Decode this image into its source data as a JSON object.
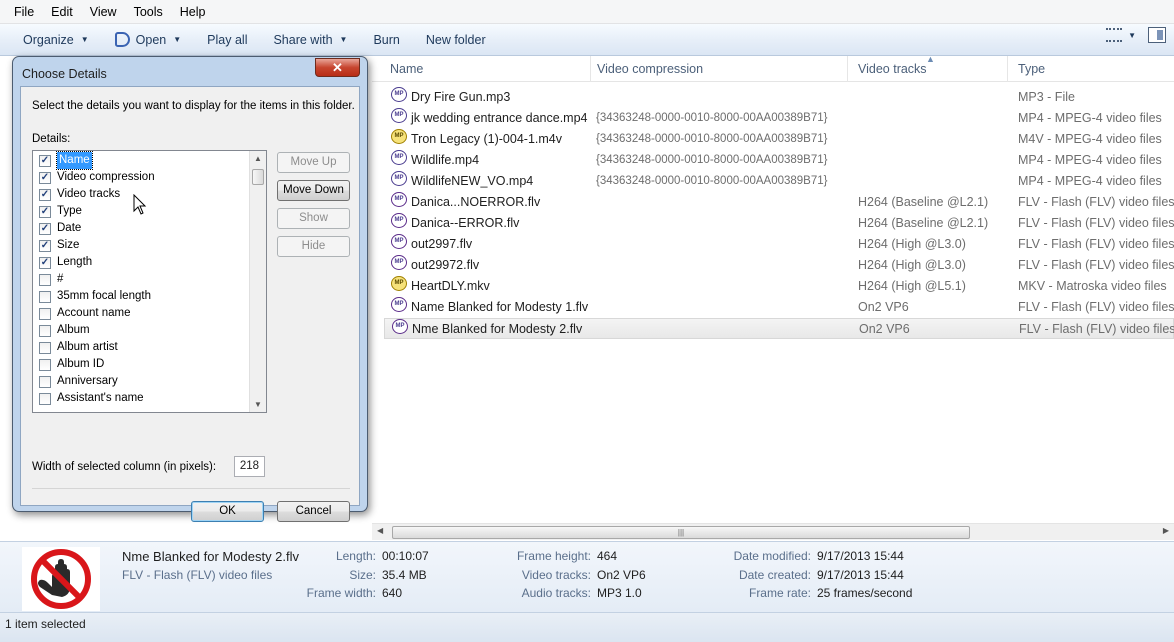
{
  "menu": [
    "File",
    "Edit",
    "View",
    "Tools",
    "Help"
  ],
  "toolbar": {
    "organize": "Organize",
    "open": "Open",
    "play_all": "Play all",
    "share_with": "Share with",
    "burn": "Burn",
    "new_folder": "New folder"
  },
  "columns": {
    "name": "Name",
    "video_compression": "Video compression",
    "video_tracks": "Video tracks",
    "type": "Type"
  },
  "files": [
    {
      "name": "Dry Fire Gun.mp3",
      "compression": "",
      "tracks": "",
      "type": "MP3 - File",
      "icon": "media-file-icon"
    },
    {
      "name": "jk wedding entrance dance.mp4",
      "compression": "{34363248-0000-0010-8000-00AA00389B71}",
      "tracks": "",
      "type": "MP4 - MPEG-4 video files",
      "icon": "media-file-icon"
    },
    {
      "name": "Tron Legacy (1)-004-1.m4v",
      "compression": "{34363248-0000-0010-8000-00AA00389B71}",
      "tracks": "",
      "type": "M4V - MPEG-4 video files",
      "icon": "media-file-icon"
    },
    {
      "name": "Wildlife.mp4",
      "compression": "{34363248-0000-0010-8000-00AA00389B71}",
      "tracks": "",
      "type": "MP4 - MPEG-4 video files",
      "icon": "media-file-icon"
    },
    {
      "name": "WildlifeNEW_VO.mp4",
      "compression": "{34363248-0000-0010-8000-00AA00389B71}",
      "tracks": "",
      "type": "MP4 - MPEG-4 video files",
      "icon": "media-file-icon"
    },
    {
      "name": "Danica...NOERROR.flv",
      "compression": "",
      "tracks": "H264 (Baseline @L2.1)",
      "type": "FLV - Flash (FLV) video files",
      "icon": "flv-file-icon"
    },
    {
      "name": "Danica--ERROR.flv",
      "compression": "",
      "tracks": "H264 (Baseline @L2.1)",
      "type": "FLV - Flash (FLV) video files",
      "icon": "flv-file-icon"
    },
    {
      "name": "out2997.flv",
      "compression": "",
      "tracks": "H264 (High @L3.0)",
      "type": "FLV - Flash (FLV) video files",
      "icon": "flv-file-icon"
    },
    {
      "name": "out29972.flv",
      "compression": "",
      "tracks": "H264 (High @L3.0)",
      "type": "FLV - Flash (FLV) video files",
      "icon": "flv-file-icon"
    },
    {
      "name": "HeartDLY.mkv",
      "compression": "",
      "tracks": "H264 (High @L5.1)",
      "type": "MKV - Matroska video files",
      "icon": "mkv-file-icon"
    },
    {
      "name": "Name Blanked for Modesty 1.flv",
      "compression": "",
      "tracks": "On2 VP6",
      "type": "FLV - Flash (FLV) video files",
      "icon": "flv-file-icon"
    },
    {
      "name": "Nme Blanked for Modesty 2.flv",
      "compression": "",
      "tracks": "On2 VP6",
      "type": "FLV - Flash (FLV) video files",
      "icon": "flv-file-icon",
      "selected": true
    }
  ],
  "dialog": {
    "title": "Choose Details",
    "close": "✕",
    "description": "Select the details you want to display for the items in this folder.",
    "details_label": "Details:",
    "items": [
      {
        "label": "Name",
        "checked": true
      },
      {
        "label": "Video compression",
        "checked": true
      },
      {
        "label": "Video tracks",
        "checked": true
      },
      {
        "label": "Type",
        "checked": true
      },
      {
        "label": "Date",
        "checked": true
      },
      {
        "label": "Size",
        "checked": true
      },
      {
        "label": "Length",
        "checked": true
      },
      {
        "label": "#",
        "checked": false
      },
      {
        "label": "35mm focal length",
        "checked": false
      },
      {
        "label": "Account name",
        "checked": false
      },
      {
        "label": "Album",
        "checked": false
      },
      {
        "label": "Album artist",
        "checked": false
      },
      {
        "label": "Album ID",
        "checked": false
      },
      {
        "label": "Anniversary",
        "checked": false
      },
      {
        "label": "Assistant's name",
        "checked": false
      }
    ],
    "move_up": "Move Up",
    "move_down": "Move Down",
    "show": "Show",
    "hide": "Hide",
    "width_label": "Width of selected column (in pixels):",
    "width_value": "218",
    "ok": "OK",
    "cancel": "Cancel"
  },
  "details_pane": {
    "filename": "Nme Blanked for Modesty 2.flv",
    "filetype": "FLV - Flash (FLV) video files",
    "length_label": "Length:",
    "length": "00:10:07",
    "size_label": "Size:",
    "size": "35.4 MB",
    "frame_width_label": "Frame width:",
    "frame_width": "640",
    "frame_height_label": "Frame height:",
    "frame_height": "464",
    "video_tracks_label": "Video tracks:",
    "video_tracks": "On2 VP6",
    "audio_tracks_label": "Audio tracks:",
    "audio_tracks": "MP3 1.0",
    "date_modified_label": "Date modified:",
    "date_modified": "9/17/2013 15:44",
    "date_created_label": "Date created:",
    "date_created": "9/17/2013 15:44",
    "frame_rate_label": "Frame rate:",
    "frame_rate": "25 frames/second"
  },
  "status": "1 item selected",
  "colors": {
    "accent": "#3399ff",
    "toolbar_text": "#1e395b",
    "close": "#c7452f"
  }
}
